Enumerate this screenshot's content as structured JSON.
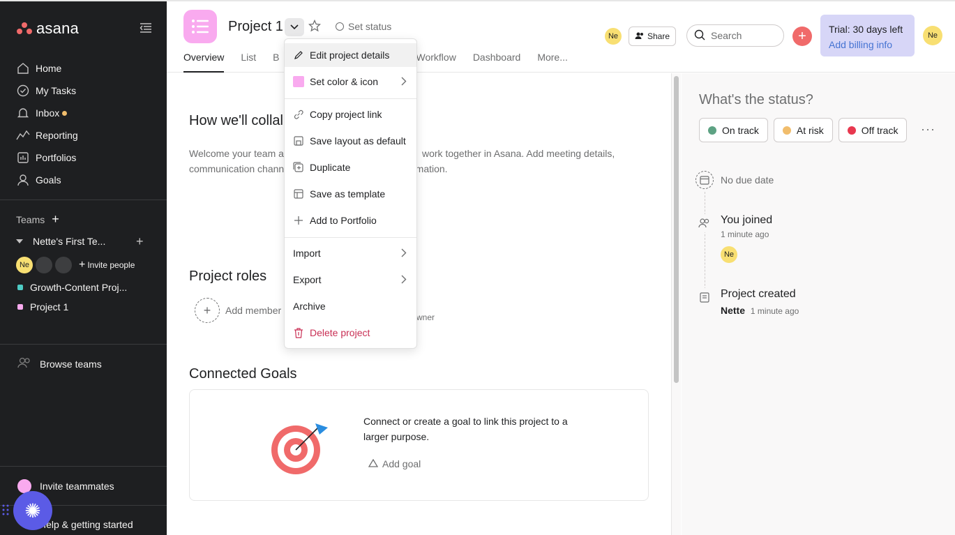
{
  "sidebar": {
    "logo_text": "asana",
    "nav": [
      {
        "label": "Home",
        "icon": "home-icon"
      },
      {
        "label": "My Tasks",
        "icon": "check-circle-icon"
      },
      {
        "label": "Inbox",
        "icon": "bell-icon"
      },
      {
        "label": "Reporting",
        "icon": "chart-icon"
      },
      {
        "label": "Portfolios",
        "icon": "portfolio-icon"
      },
      {
        "label": "Goals",
        "icon": "person-icon"
      }
    ],
    "teams_label": "Teams",
    "team_name": "Nette's First Te...",
    "member_avatar": "Ne",
    "invite_people": "Invite people",
    "projects": [
      {
        "label": "Growth-Content Proj...",
        "color": "#4ecbc4"
      },
      {
        "label": "Project 1",
        "color": "#f9aaef"
      }
    ],
    "browse_teams": "Browse teams",
    "invite_teammates": "Invite teammates",
    "help": "Help & getting started"
  },
  "header": {
    "project_title": "Project 1",
    "set_status": "Set status",
    "tabs": [
      "Overview",
      "List",
      "B",
      "Workflow",
      "Dashboard",
      "More..."
    ],
    "avatar": "Ne",
    "share": "Share",
    "search_placeholder": "Search",
    "trial_line1": "Trial: 30 days left",
    "trial_line2": "Add billing info"
  },
  "main": {
    "collab_title": "How we'll collal",
    "collab_text_1": "Welcome your team a",
    "collab_text_1b": "work together in Asana. Add meeting details,",
    "collab_text_2": "communication chann",
    "collab_text_2b": "rmation.",
    "roles_title": "Project roles",
    "add_member": "Add member",
    "owner_label": "wner",
    "goals_title": "Connected Goals",
    "goal_text": "Connect or create a goal to link this project to a larger purpose.",
    "add_goal": "Add goal"
  },
  "menu": {
    "items": [
      {
        "label": "Edit project details",
        "icon": "pencil-icon"
      },
      {
        "label": "Set color & icon",
        "icon": "color-swatch-icon"
      },
      {
        "label": "Copy project link",
        "icon": "link-icon"
      },
      {
        "label": "Save layout as default",
        "icon": "save-layout-icon"
      },
      {
        "label": "Duplicate",
        "icon": "duplicate-icon"
      },
      {
        "label": "Save as template",
        "icon": "template-icon"
      },
      {
        "label": "Add to Portfolio",
        "icon": "plus-icon"
      },
      {
        "label": "Import",
        "icon": ""
      },
      {
        "label": "Export",
        "icon": ""
      },
      {
        "label": "Archive",
        "icon": ""
      },
      {
        "label": "Delete project",
        "icon": "trash-icon"
      }
    ]
  },
  "status_panel": {
    "question": "What's the status?",
    "buttons": [
      {
        "label": "On track",
        "color": "#5da283"
      },
      {
        "label": "At risk",
        "color": "#f1bd6c"
      },
      {
        "label": "Off track",
        "color": "#e8384f"
      }
    ],
    "no_due_date": "No due date",
    "joined_title": "You joined",
    "joined_time": "1 minute ago",
    "joined_avatar": "Ne",
    "created_title": "Project created",
    "created_by": "Nette",
    "created_time": "1 minute ago"
  }
}
